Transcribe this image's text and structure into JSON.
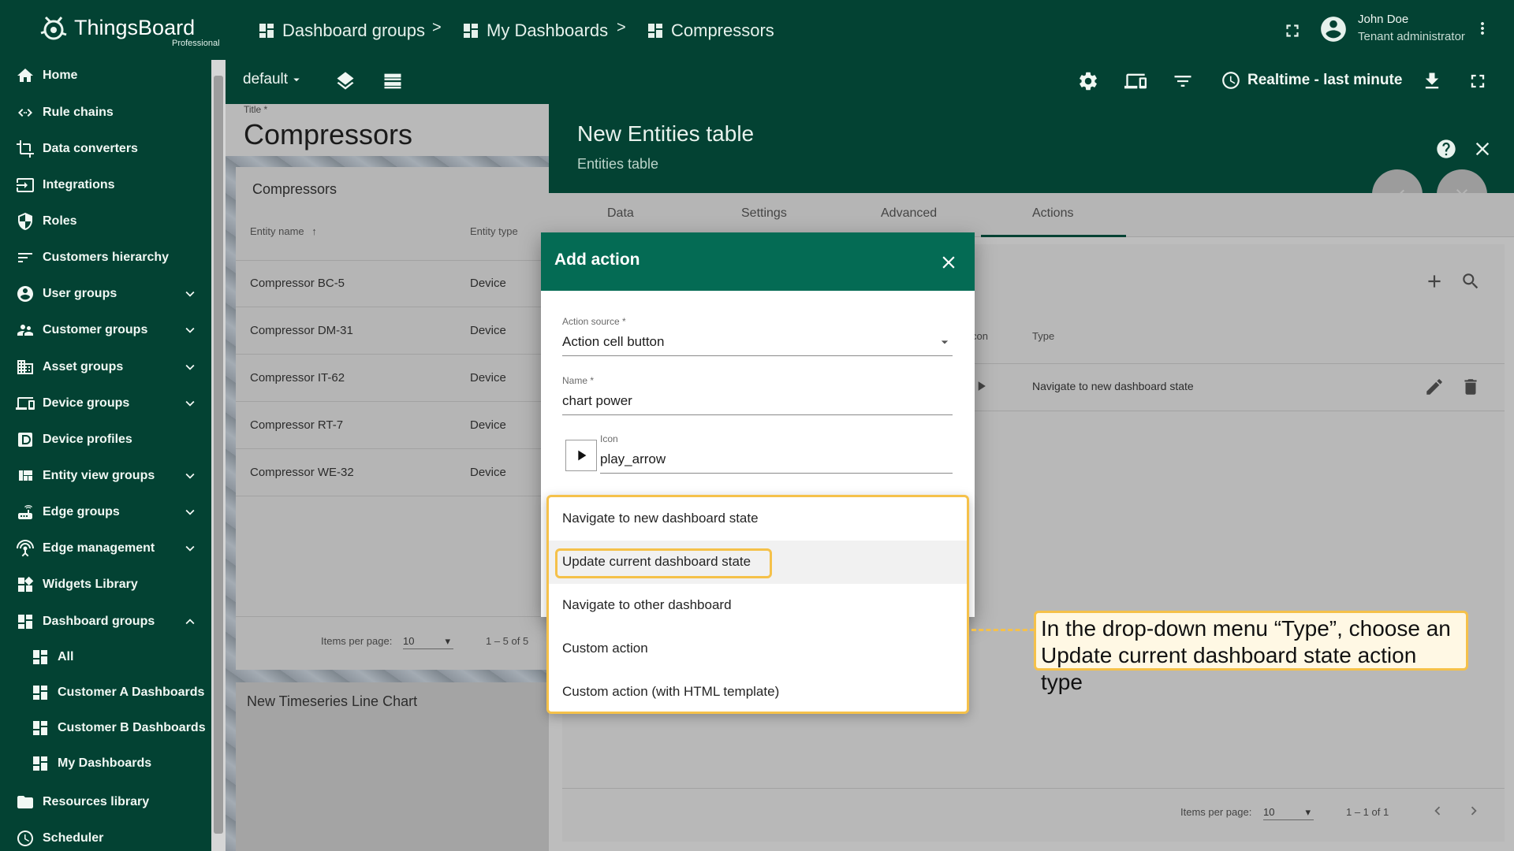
{
  "app": {
    "brand": "ThingsBoard",
    "edition": "Professional",
    "breadcrumbs": [
      "Dashboard groups",
      "My Dashboards",
      "Compressors"
    ],
    "user": {
      "name": "John Doe",
      "role": "Tenant administrator"
    }
  },
  "sidebar": {
    "items": [
      {
        "label": "Home",
        "icon": "home-icon"
      },
      {
        "label": "Rule chains",
        "icon": "code-arrows-icon"
      },
      {
        "label": "Data converters",
        "icon": "crop-icon"
      },
      {
        "label": "Integrations",
        "icon": "input-icon"
      },
      {
        "label": "Roles",
        "icon": "shield-icon"
      },
      {
        "label": "Customers hierarchy",
        "icon": "sort-icon"
      },
      {
        "label": "User groups",
        "icon": "account-circle-icon"
      },
      {
        "label": "Customer groups",
        "icon": "supervisor-icon"
      },
      {
        "label": "Asset groups",
        "icon": "domain-icon"
      },
      {
        "label": "Device groups",
        "icon": "devices-icon"
      },
      {
        "label": "Device profiles",
        "icon": "device-profile-icon"
      },
      {
        "label": "Entity view groups",
        "icon": "view-quilt-icon"
      },
      {
        "label": "Edge groups",
        "icon": "router-icon"
      },
      {
        "label": "Edge management",
        "icon": "settings-input-antenna-icon"
      },
      {
        "label": "Widgets Library",
        "icon": "widgets-icon"
      },
      {
        "label": "Dashboard groups",
        "icon": "dashboard-icon"
      },
      {
        "label": "All",
        "icon": "dashboard-icon"
      },
      {
        "label": "Customer A Dashboards",
        "icon": "dashboard-icon"
      },
      {
        "label": "Customer B Dashboards",
        "icon": "dashboard-icon"
      },
      {
        "label": "My Dashboards",
        "icon": "dashboard-icon"
      },
      {
        "label": "Resources library",
        "icon": "folder-icon"
      },
      {
        "label": "Scheduler",
        "icon": "schedule-icon"
      }
    ]
  },
  "toolbar": {
    "state": "default",
    "timewindow": "Realtime - last minute"
  },
  "dashboard": {
    "title_label": "Title *",
    "title": "Compressors",
    "table_widget": {
      "title": "Compressors",
      "columns": [
        "Entity name",
        "Entity type"
      ],
      "rows": [
        [
          "Compressor BC-5",
          "Device"
        ],
        [
          "Compressor DM-31",
          "Device"
        ],
        [
          "Compressor IT-62",
          "Device"
        ],
        [
          "Compressor RT-7",
          "Device"
        ],
        [
          "Compressor WE-32",
          "Device"
        ]
      ],
      "items_per_page_label": "Items per page:",
      "items_per_page": "10",
      "range": "1 – 5 of 5"
    },
    "chart_widget_title": "New Timeseries Line Chart"
  },
  "editor": {
    "title": "New Entities table",
    "subtitle": "Entities table",
    "tabs": [
      "Data",
      "Settings",
      "Advanced",
      "Actions"
    ],
    "active_tab": "Actions",
    "actions_table": {
      "col_icon": "con",
      "col_type": "Type",
      "row_type": "Navigate to new dashboard state",
      "items_per_page_label": "Items per page:",
      "items_per_page": "10",
      "range": "1 – 1 of 1"
    }
  },
  "dialog": {
    "title": "Add action",
    "action_source_label": "Action source *",
    "action_source_value": "Action cell button",
    "name_label": "Name *",
    "name_value": "chart power",
    "icon_label": "Icon",
    "icon_value": "play_arrow",
    "type_options": [
      "Navigate to new dashboard state",
      "Update current dashboard state",
      "Navigate to other dashboard",
      "Custom action",
      "Custom action (with HTML template)"
    ],
    "selected_option": "Update current dashboard state"
  },
  "callout": {
    "text": "In the drop-down menu “Type”, choose an Update current dashboard state action type"
  },
  "colors": {
    "primary": "#034233",
    "dialog_header": "#046b54",
    "highlight": "#f5c14a",
    "callout_bg": "#fff8e4"
  }
}
